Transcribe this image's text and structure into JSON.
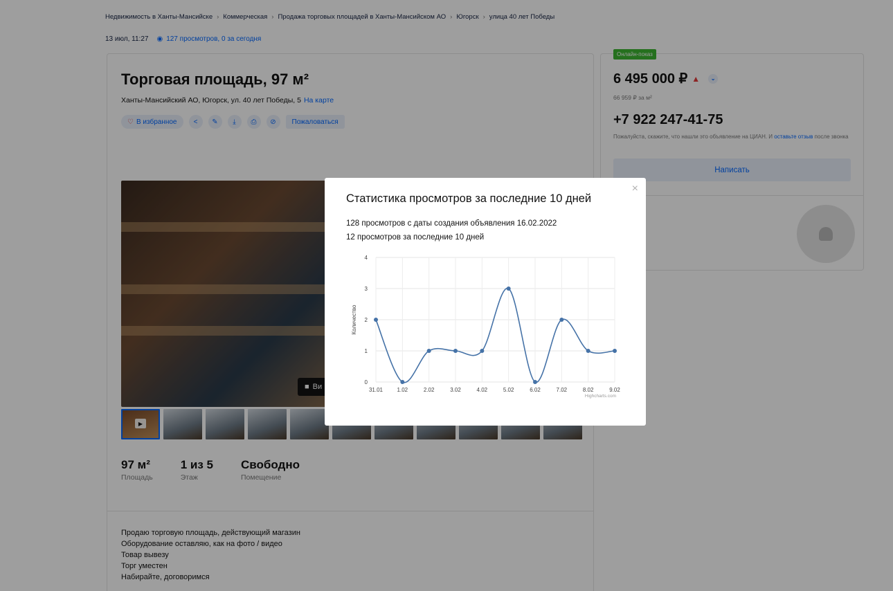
{
  "breadcrumbs": [
    "Недвижимость в Ханты-Мансийске",
    "Коммерческая",
    "Продажа торговых площадей в Ханты-Мансийском АО",
    "Югорск",
    "улица 40 лет Победы"
  ],
  "meta": {
    "published": "13 июл, 11:27",
    "views": "127 просмотров, 0 за сегодня"
  },
  "listing": {
    "title": "Торговая площадь, 97 м²",
    "address": "Ханты-Мансийский АО, Югорск, ул. 40 лет Победы, 5",
    "map_link": "На карте",
    "favorite_label": "В избранное",
    "complain_label": "Пожаловаться",
    "video_label": "Ви",
    "facts": [
      {
        "value": "97 м²",
        "label": "Площадь"
      },
      {
        "value": "1 из 5",
        "label": "Этаж"
      },
      {
        "value": "Свободно",
        "label": "Помещение"
      }
    ],
    "description": [
      "Продаю торговую площадь, действующий магазин",
      "Оборудование оставляю, как на фото / видео",
      "Товар вывезу",
      "Торг уместен",
      "Набирайте, договоримся"
    ]
  },
  "sidebar": {
    "online_badge": "Онлайн-показ",
    "price": "6 495 000 ₽",
    "price_per_m": "66 959 ₽ за м²",
    "phone": "+7 922 247-41-75",
    "phone_note_pre": "Пожалуйста, скажите, что нашли это объявление на ЦИАН. И ",
    "phone_note_link": "оставьте отзыв",
    "phone_note_post": " после звонка",
    "write_label": "Написать",
    "agent_id": "5571"
  },
  "modal": {
    "close": "×",
    "title": "Статистика просмотров за последние 10 дней",
    "line1": "128 просмотров с даты создания объявления 16.02.2022",
    "line2": "12 просмотров за последние 10 дней"
  },
  "icons": {
    "eye": "eye-icon",
    "heart": "heart-icon",
    "share": "share-icon",
    "edit": "pencil-icon",
    "download": "download-icon",
    "print": "print-icon",
    "hide": "hide-icon",
    "close": "close-icon",
    "user": "user-icon"
  },
  "colors": {
    "accent": "#0468ff",
    "online": "#3cb531",
    "price_up": "#e23a3a",
    "series": "#4572a7"
  },
  "chart_data": {
    "type": "line",
    "categories": [
      "31.01",
      "1.02",
      "2.02",
      "3.02",
      "4.02",
      "5.02",
      "6.02",
      "7.02",
      "8.02",
      "9.02"
    ],
    "series": [
      {
        "values": [
          2,
          0,
          1,
          1,
          1,
          3,
          0,
          2,
          1,
          1
        ]
      }
    ],
    "ylabel": "Количество",
    "ylim": [
      0,
      4
    ],
    "yticks": [
      0,
      1,
      2,
      3,
      4
    ],
    "grid": true,
    "credits": "Highcharts.com"
  }
}
